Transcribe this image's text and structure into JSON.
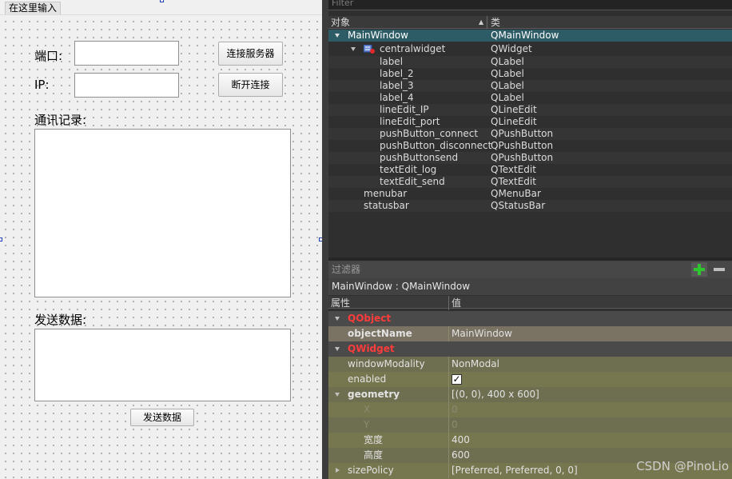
{
  "designer": {
    "menu_placeholder": "在这里输入",
    "label_port": "端口:",
    "label_ip": "IP:",
    "btn_connect": "连接服务器",
    "btn_disconnect": "断开连接",
    "label_log": "通讯记录:",
    "label_send": "发送数据:",
    "btn_send": "发送数据"
  },
  "object_inspector": {
    "filter_placeholder": "Filter",
    "col_object": "对象",
    "col_class": "类",
    "rows": [
      {
        "name": "MainWindow",
        "cls": "QMainWindow"
      },
      {
        "name": "centralwidget",
        "cls": "QWidget"
      },
      {
        "name": "label",
        "cls": "QLabel"
      },
      {
        "name": "label_2",
        "cls": "QLabel"
      },
      {
        "name": "label_3",
        "cls": "QLabel"
      },
      {
        "name": "label_4",
        "cls": "QLabel"
      },
      {
        "name": "lineEdit_IP",
        "cls": "QLineEdit"
      },
      {
        "name": "lineEdit_port",
        "cls": "QLineEdit"
      },
      {
        "name": "pushButton_connect",
        "cls": "QPushButton"
      },
      {
        "name": "pushButton_disconnect",
        "cls": "QPushButton"
      },
      {
        "name": "pushButtonsend",
        "cls": "QPushButton"
      },
      {
        "name": "textEdit_log",
        "cls": "QTextEdit"
      },
      {
        "name": "textEdit_send",
        "cls": "QTextEdit"
      },
      {
        "name": "menubar",
        "cls": "QMenuBar"
      },
      {
        "name": "statusbar",
        "cls": "QStatusBar"
      }
    ]
  },
  "property_editor": {
    "filter_placeholder": "过滤器",
    "title": "MainWindow : QMainWindow",
    "col_property": "属性",
    "col_value": "值",
    "rows": [
      {
        "name": "QObject",
        "value": ""
      },
      {
        "name": "objectName",
        "value": "MainWindow"
      },
      {
        "name": "QWidget",
        "value": ""
      },
      {
        "name": "windowModality",
        "value": "NonModal"
      },
      {
        "name": "enabled",
        "value": "✓"
      },
      {
        "name": "geometry",
        "value": "[(0, 0), 400 x 600]"
      },
      {
        "name": "X",
        "value": "0"
      },
      {
        "name": "Y",
        "value": "0"
      },
      {
        "name": "宽度",
        "value": "400"
      },
      {
        "name": "高度",
        "value": "600"
      },
      {
        "name": "sizePolicy",
        "value": "[Preferred, Preferred, 0, 0]"
      }
    ]
  },
  "watermark": "CSDN @PinoLio",
  "colors": {
    "selected_row": "#2d5c66",
    "category_text": "#ff3b3b",
    "add_icon": "#2ec52e"
  }
}
